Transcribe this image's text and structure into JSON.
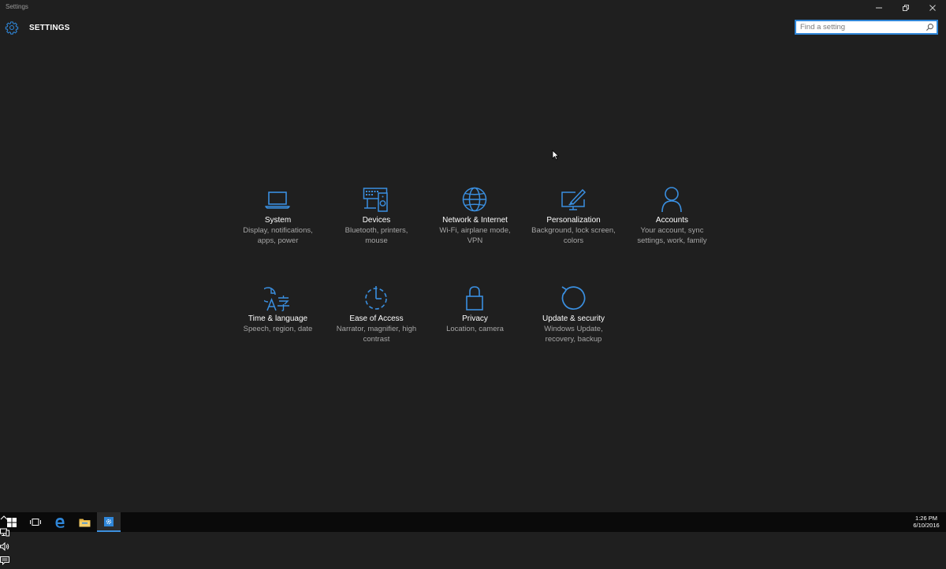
{
  "window": {
    "title": "Settings"
  },
  "header": {
    "app_title": "SETTINGS",
    "icon": "gear-icon"
  },
  "search": {
    "placeholder": "Find a setting",
    "value": ""
  },
  "colors": {
    "accent": "#2f86d8",
    "icon_blue": "#3a8fe0",
    "background": "#1f1f1f",
    "description_text": "#a6a6a6",
    "taskbar": "#0a0a0a"
  },
  "categories": [
    {
      "name": "System",
      "description": "Display, notifications, apps, power",
      "icon": "laptop-icon"
    },
    {
      "name": "Devices",
      "description": "Bluetooth, printers, mouse",
      "icon": "devices-icon"
    },
    {
      "name": "Network & Internet",
      "description": "Wi-Fi, airplane mode, VPN",
      "icon": "globe-icon"
    },
    {
      "name": "Personalization",
      "description": "Background, lock screen, colors",
      "icon": "paint-icon"
    },
    {
      "name": "Accounts",
      "description": "Your account, sync settings, work, family",
      "icon": "person-icon"
    },
    {
      "name": "Time & language",
      "description": "Speech, region, date",
      "icon": "time-language-icon"
    },
    {
      "name": "Ease of Access",
      "description": "Narrator, magnifier, high contrast",
      "icon": "ease-of-access-icon"
    },
    {
      "name": "Privacy",
      "description": "Location, camera",
      "icon": "lock-icon"
    },
    {
      "name": "Update & security",
      "description": "Windows Update, recovery, backup",
      "icon": "update-icon"
    }
  ],
  "taskbar": {
    "buttons": [
      "windows-start-icon",
      "task-view-icon",
      "edge-icon",
      "file-explorer-icon",
      "settings-icon"
    ],
    "active": "settings-icon",
    "tray_icons": [
      "chevron-up-icon",
      "network-icon",
      "volume-icon",
      "action-center-icon"
    ],
    "clock": {
      "time": "1:26 PM",
      "date": "6/10/2016"
    }
  }
}
